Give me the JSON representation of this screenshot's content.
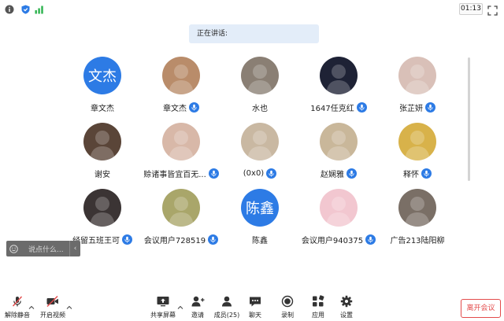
{
  "topbar": {
    "clock": "01:13",
    "icons": [
      "info-icon",
      "shield-icon",
      "signal-icon",
      "fullscreen-icon"
    ]
  },
  "speaking": {
    "label": "正在讲话:"
  },
  "participants": [
    {
      "name": "章文杰",
      "avatar_text": "文杰",
      "avatar_color": "#2d7be5",
      "mic": false
    },
    {
      "name": "章文杰",
      "avatar_text": "",
      "avatar_color": "#b98c6a",
      "mic": true
    },
    {
      "name": "水也",
      "avatar_text": "",
      "avatar_color": "#8a7f74",
      "mic": false
    },
    {
      "name": "1647任克红",
      "avatar_text": "",
      "avatar_color": "#1e2235",
      "mic": true
    },
    {
      "name": "张芷妍",
      "avatar_text": "",
      "avatar_color": "#d9c0b8",
      "mic": true
    },
    {
      "name": "谢安",
      "avatar_text": "",
      "avatar_color": "#5a4538",
      "mic": false
    },
    {
      "name": "赊诸事皆宜百无...",
      "avatar_text": "",
      "avatar_color": "#d8b8a8",
      "mic": true
    },
    {
      "name": "(0x0)",
      "avatar_text": "",
      "avatar_color": "#c9b8a2",
      "mic": true
    },
    {
      "name": "赵娴雅",
      "avatar_text": "",
      "avatar_color": "#c9b79a",
      "mic": true
    },
    {
      "name": "释怀",
      "avatar_text": "",
      "avatar_color": "#d8b24a",
      "mic": true
    },
    {
      "name": "经留五班王可",
      "avatar_text": "",
      "avatar_color": "#3b3434",
      "mic": true
    },
    {
      "name": "会议用户728519",
      "avatar_text": "",
      "avatar_color": "#a9a66a",
      "mic": true
    },
    {
      "name": "陈鑫",
      "avatar_text": "陈鑫",
      "avatar_color": "#2d7be5",
      "mic": false
    },
    {
      "name": "会议用户940375",
      "avatar_text": "",
      "avatar_color": "#f2c7d0",
      "mic": true
    },
    {
      "name": "广告213陆阳柳",
      "avatar_text": "",
      "avatar_color": "#7a6f66",
      "mic": false
    }
  ],
  "chat": {
    "placeholder": "说点什么...",
    "collapse": "‹"
  },
  "toolbar": {
    "unmute": "解除静音",
    "start_video": "开启视频",
    "share_screen": "共享屏幕",
    "invite": "邀请",
    "members": "成员(25)",
    "chat": "聊天",
    "record": "录制",
    "apps": "应用",
    "settings": "设置",
    "leave": "离开会议"
  },
  "colors": {
    "accent": "#2d7be5",
    "leave": "#e34b4b",
    "muted_red": "#e34b4b"
  }
}
